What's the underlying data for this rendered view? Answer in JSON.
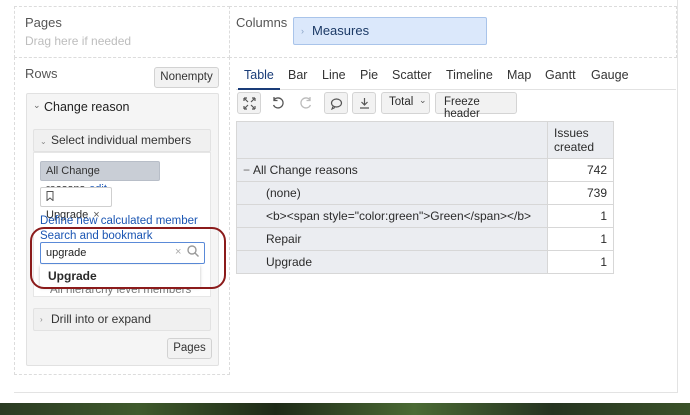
{
  "pages": {
    "title": "Pages",
    "hint": "Drag here if needed"
  },
  "columns": {
    "title": "Columns",
    "measure_chip": "Measures"
  },
  "rows": {
    "title": "Rows",
    "nonempty_label": "Nonempty",
    "dimension": "Change reason",
    "select_members_label": "Select individual members",
    "all_chip_label": "All Change reasons",
    "edit_label": "edit",
    "bookmark_chip_label": "Upgrade",
    "define_link": "Define new calculated member",
    "search_label": "Search and bookmark",
    "search_value": "upgrade",
    "dropdown_item": "Upgrade",
    "hidden_item": "All hierarchy level members",
    "drill_label": "Drill into or expand",
    "pages_button": "Pages"
  },
  "tabs": [
    "Table",
    "Bar",
    "Line",
    "Pie",
    "Scatter",
    "Timeline",
    "Map",
    "Gantt",
    "Gauge"
  ],
  "toolbar": {
    "total_label": "Total",
    "freeze_label": "Freeze header"
  },
  "table": {
    "column_header": "Issues created",
    "rows": [
      {
        "label": "All Change reasons",
        "value": "742"
      },
      {
        "label": "(none)",
        "value": "739"
      },
      {
        "label": "<b><span style=\"color:green\">Green</span></b>",
        "value": "1"
      },
      {
        "label": "Repair",
        "value": "1"
      },
      {
        "label": "Upgrade",
        "value": "1"
      }
    ]
  },
  "colors": {
    "accent": "#1a3c78",
    "link": "#1a55b3",
    "highlight_ring": "#8b1b1b"
  }
}
